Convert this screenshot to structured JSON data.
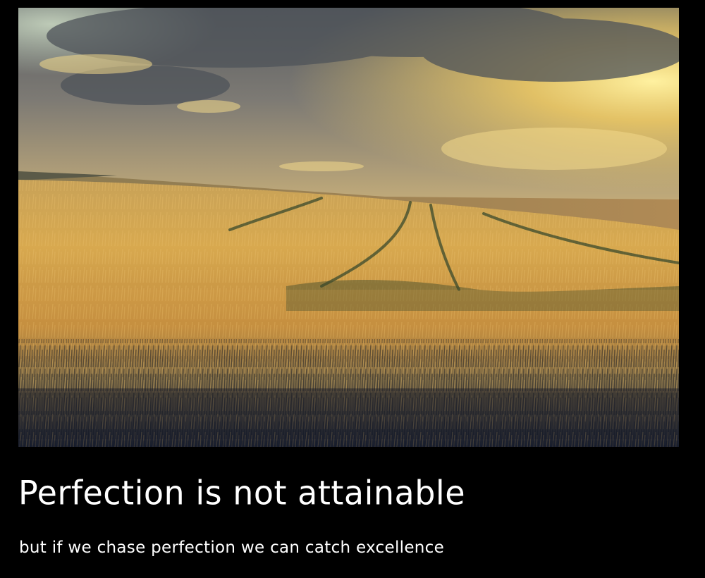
{
  "hero_image": {
    "subject": "wheat field at sunset under cloudy sky",
    "colors": {
      "sky_top": "#5d5f61",
      "sky_glow": "#f5d36a",
      "field_light": "#d7a74e",
      "field_dark": "#2b3040"
    }
  },
  "headline": "Perfection is not attainable",
  "subheadline": "but if we chase perfection we can catch excellence"
}
